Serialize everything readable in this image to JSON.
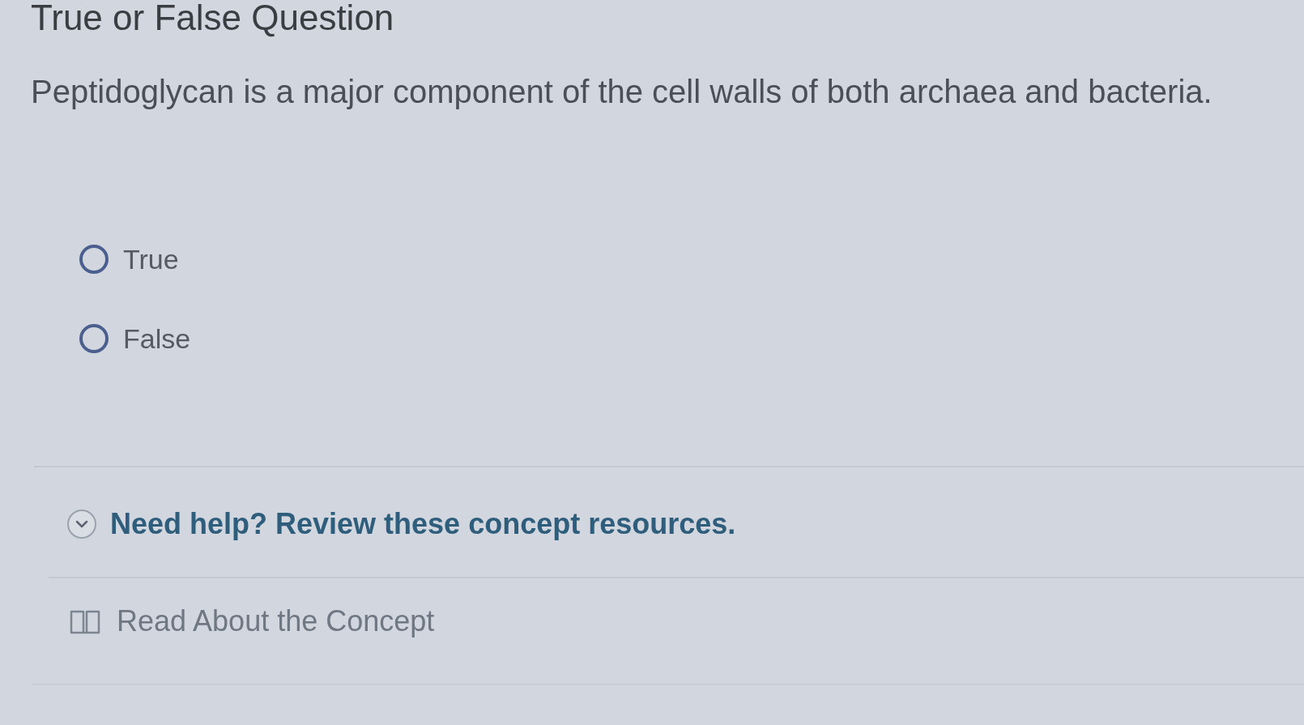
{
  "title": "True or False Question",
  "question": "Peptidoglycan is a major component of the cell walls of both archaea and bacteria.",
  "options": [
    {
      "label": "True",
      "selected": false
    },
    {
      "label": "False",
      "selected": false
    }
  ],
  "help": {
    "label": "Need help? Review these concept resources."
  },
  "resources": [
    {
      "label": "Read About the Concept"
    }
  ]
}
